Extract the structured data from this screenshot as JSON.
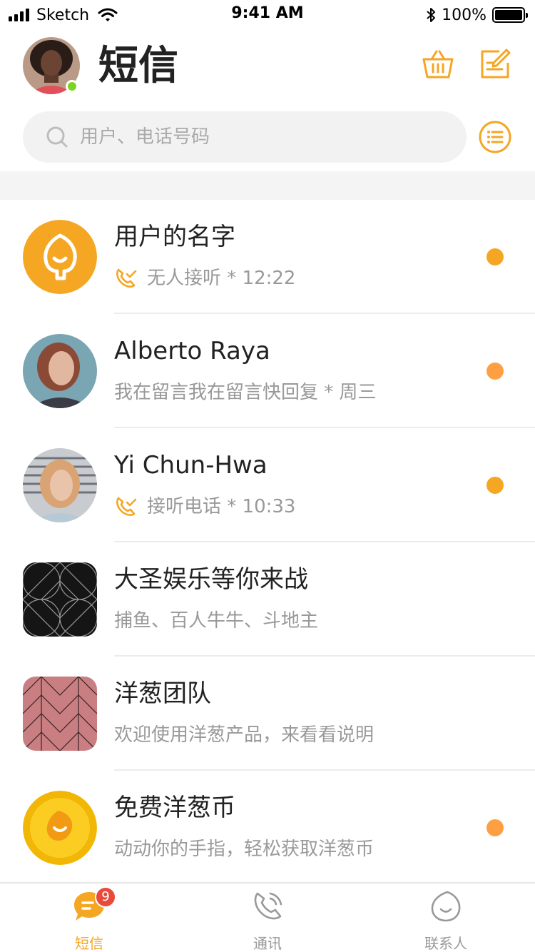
{
  "status_bar": {
    "carrier": "Sketch",
    "time": "9:41 AM",
    "battery": "100%"
  },
  "header": {
    "title": "短信",
    "basket_icon": "basket-icon",
    "compose_icon": "compose-icon"
  },
  "search": {
    "placeholder": "用户、电话号码",
    "value": ""
  },
  "colors": {
    "accent": "#f5a623",
    "unread_orange": "#ff9f43",
    "badge_red": "#e84a3c",
    "online_green": "#7ed321"
  },
  "messages": [
    {
      "name": "用户的名字",
      "subtitle": "无人接听 * 12:22",
      "has_call_icon": true,
      "unread": true
    },
    {
      "name": "Alberto Raya",
      "subtitle": "我在留言我在留言快回复 * 周三",
      "has_call_icon": false,
      "unread": true
    },
    {
      "name": "Yi Chun-Hwa",
      "subtitle": "接听电话 * 10:33",
      "has_call_icon": true,
      "unread": true
    },
    {
      "name": "大圣娱乐等你来战",
      "subtitle": "捕鱼、百人牛牛、斗地主",
      "has_call_icon": false,
      "unread": false
    },
    {
      "name": "洋葱团队",
      "subtitle": "欢迎使用洋葱产品，来看看说明",
      "has_call_icon": false,
      "unread": false
    },
    {
      "name": "免费洋葱币",
      "subtitle": "动动你的手指，轻松获取洋葱币",
      "has_call_icon": false,
      "unread": true
    }
  ],
  "tabs": [
    {
      "label": "短信",
      "icon": "chat-bubble-icon",
      "badge": "9",
      "active": true
    },
    {
      "label": "通讯",
      "icon": "phone-icon",
      "active": false
    },
    {
      "label": "联系人",
      "icon": "contact-icon",
      "active": false
    }
  ]
}
